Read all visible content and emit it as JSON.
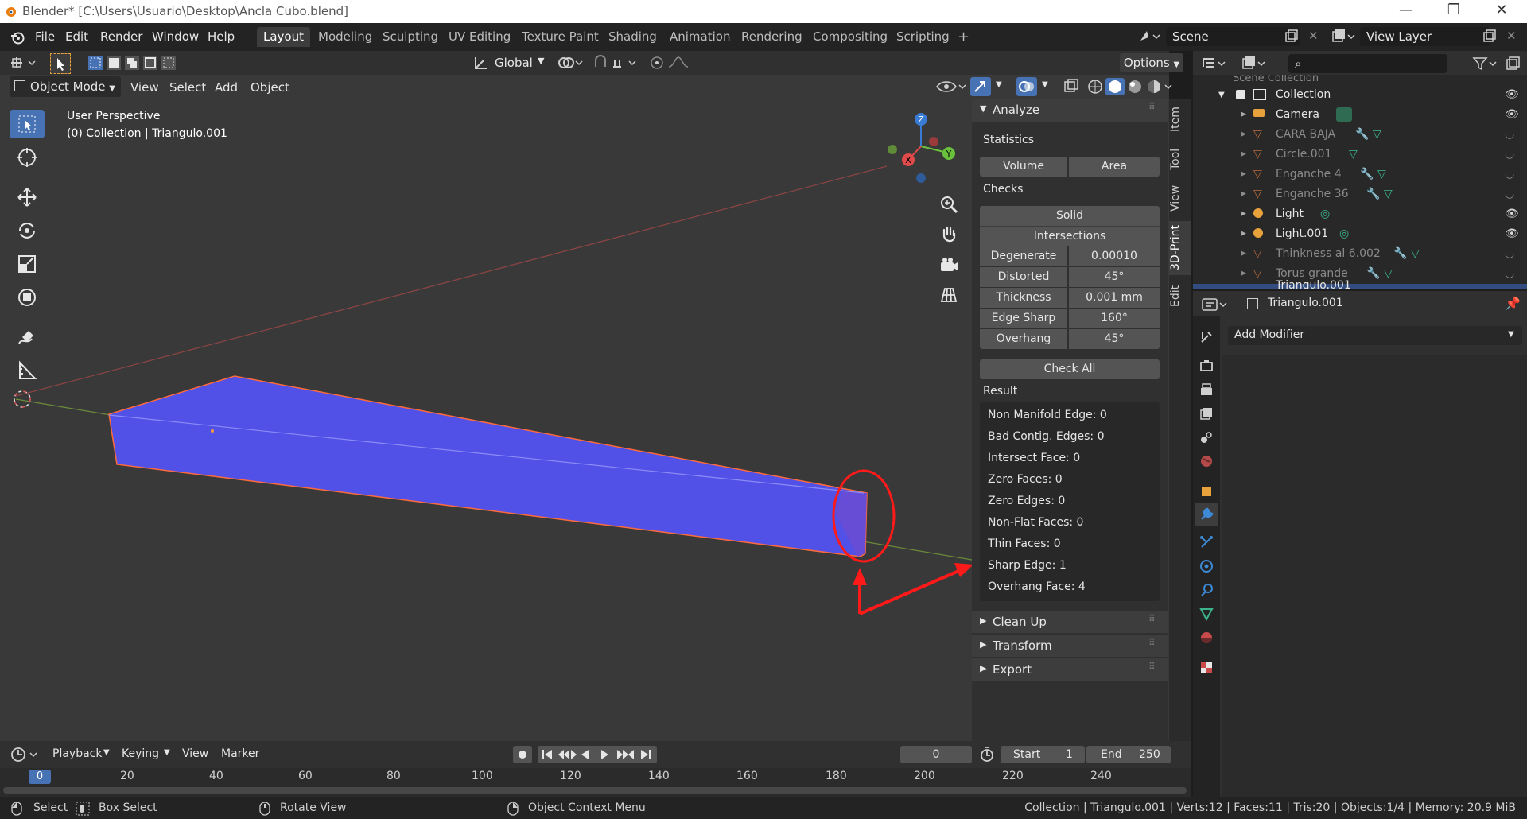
{
  "window": {
    "title": "Blender* [C:\\Users\\Usuario\\Desktop\\Ancla Cubo.blend]",
    "minimize": "—",
    "restore": "❐",
    "close": "✕"
  },
  "menu": [
    "File",
    "Edit",
    "Render",
    "Window",
    "Help"
  ],
  "workspaces": [
    "Layout",
    "Modeling",
    "Sculpting",
    "UV Editing",
    "Texture Paint",
    "Shading",
    "Animation",
    "Rendering",
    "Compositing",
    "Scripting"
  ],
  "workspace_add": "+",
  "scene": {
    "label": "Scene",
    "view_layer": "View Layer"
  },
  "viewport_header": {
    "transform": "Global",
    "options": "Options",
    "mode": "Object Mode",
    "menus": [
      "View",
      "Select",
      "Add",
      "Object"
    ]
  },
  "viewport_overlay": {
    "perspective": "User Perspective",
    "collection": "(0) Collection | Triangulo.001"
  },
  "gizmo": {
    "x": "X",
    "y": "Y",
    "z": "Z"
  },
  "sidebar_tabs": [
    "Item",
    "Tool",
    "View",
    "3D-Print",
    "Edit"
  ],
  "analyze": {
    "title": "Analyze",
    "statistics_label": "Statistics",
    "volume": "Volume",
    "area": "Area",
    "checks_label": "Checks",
    "solid": "Solid",
    "intersections": "Intersections",
    "rows": [
      {
        "label": "Degenerate",
        "value": "0.00010"
      },
      {
        "label": "Distorted",
        "value": "45°"
      },
      {
        "label": "Thickness",
        "value": "0.001 mm"
      },
      {
        "label": "Edge Sharp",
        "value": "160°"
      },
      {
        "label": "Overhang",
        "value": "45°"
      }
    ],
    "check_all": "Check All",
    "result_label": "Result",
    "results": [
      "Non Manifold Edge: 0",
      "Bad Contig. Edges: 0",
      "Intersect Face: 0",
      "Zero Faces: 0",
      "Zero Edges: 0",
      "Non-Flat Faces: 0",
      "Thin Faces: 0",
      "Sharp Edge: 1",
      "Overhang Face: 4"
    ]
  },
  "collapsed_panels": [
    "Clean Up",
    "Transform",
    "Export"
  ],
  "outliner": {
    "scene_collection": "Scene Collection",
    "collection": "Collection",
    "items": [
      {
        "name": "Camera",
        "dim": false
      },
      {
        "name": "CARA BAJA",
        "dim": true
      },
      {
        "name": "Circle.001",
        "dim": true
      },
      {
        "name": "Enganche 4",
        "dim": true
      },
      {
        "name": "Enganche 36",
        "dim": true
      },
      {
        "name": "Light",
        "dim": false
      },
      {
        "name": "Light.001",
        "dim": false
      },
      {
        "name": "Thinkness al 6.002",
        "dim": true
      },
      {
        "name": "Torus grande",
        "dim": true
      },
      {
        "name": "Triangulo.001",
        "dim": false
      }
    ]
  },
  "properties": {
    "object": "Triangulo.001",
    "add_modifier": "Add Modifier"
  },
  "timeline": {
    "menus": [
      "Playback",
      "Keying",
      "View",
      "Marker"
    ],
    "current_frame": "0",
    "start_label": "Start",
    "start": "1",
    "end_label": "End",
    "end": "250",
    "ruler": [
      "0",
      "20",
      "40",
      "60",
      "80",
      "100",
      "120",
      "140",
      "160",
      "180",
      "200",
      "220",
      "240"
    ]
  },
  "status": {
    "select": "Select",
    "box_select": "Box Select",
    "rotate_view": "Rotate View",
    "context_menu": "Object Context Menu",
    "info": "Collection | Triangulo.001 | Verts:12 | Faces:11 | Tris:20 | Objects:1/4 | Memory: 20.9 MiB"
  },
  "colors": {
    "accent": "#4772b3",
    "mesh": "#5151e8",
    "outline": "#ff6a3c",
    "annotation": "#ff1a1a"
  }
}
